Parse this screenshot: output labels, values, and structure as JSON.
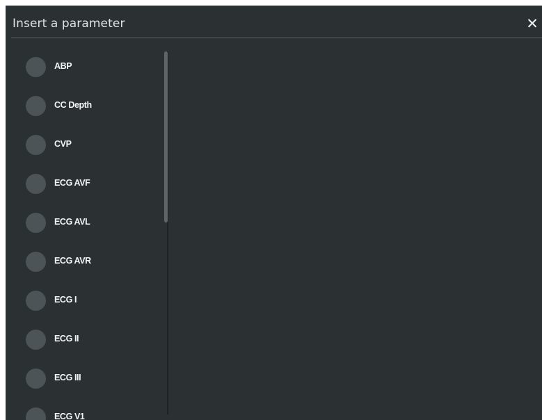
{
  "dialog": {
    "title": "Insert a parameter",
    "close_glyph": "✕",
    "close_icon": "close-icon"
  },
  "parameters": [
    {
      "label": "ABP",
      "selected": false
    },
    {
      "label": "CC Depth",
      "selected": false
    },
    {
      "label": "CVP",
      "selected": false
    },
    {
      "label": "ECG AVF",
      "selected": false
    },
    {
      "label": "ECG AVL",
      "selected": false
    },
    {
      "label": "ECG AVR",
      "selected": false
    },
    {
      "label": "ECG I",
      "selected": false
    },
    {
      "label": "ECG II",
      "selected": false
    },
    {
      "label": "ECG III",
      "selected": false
    },
    {
      "label": "ECG V1",
      "selected": false
    }
  ],
  "colors": {
    "dialog_background": "#2b3133",
    "radio_fill": "#4d5457",
    "text": "#f2f4f5"
  }
}
